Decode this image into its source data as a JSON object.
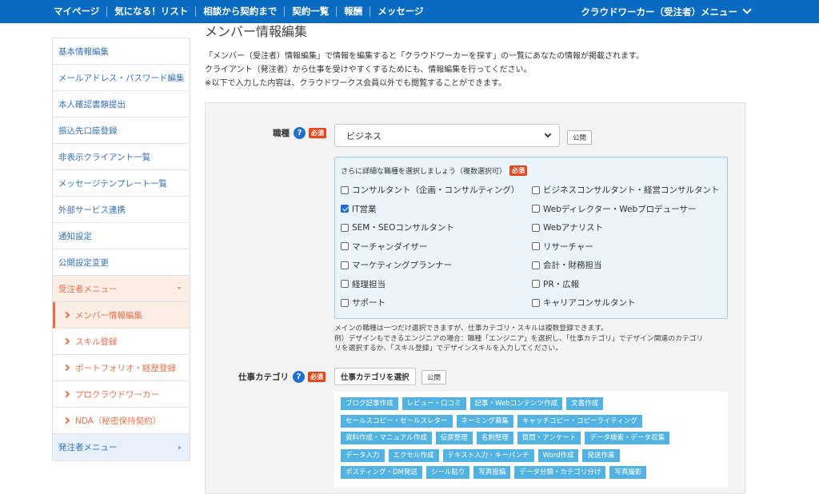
{
  "topnav": {
    "items": [
      "マイページ",
      "気になる！リスト",
      "相談から契約まで",
      "契約一覧",
      "報酬",
      "メッセージ"
    ],
    "menu_label": "クラウドワーカー（受注者）メニュー"
  },
  "sidebar": {
    "items": [
      "基本情報編集",
      "メールアドレス・パスワード編集",
      "本人確認書類提出",
      "振込先口座登録",
      "非表示クライアント一覧",
      "メッセージテンプレート一覧",
      "外部サービス連携",
      "通知設定",
      "公開設定変更"
    ],
    "worker_menu": "受注者メニュー",
    "worker_sub": [
      "メンバー情報編集",
      "スキル登録",
      "ポートフォリオ・経歴登録",
      "プロクラウドワーカー",
      "NDA（秘密保持契約）"
    ],
    "client_menu": "発注者メニュー"
  },
  "main": {
    "title": "メンバー情報編集",
    "intro": [
      "「メンバー（受注者）情報編集」で情報を編集すると「クラウドワーカーを探す」の一覧にあなたの情報が掲載されます。",
      "クライアント（発注者）から仕事を受けやすくするためにも、情報編集を行ってください。",
      "※以下で入力した内容は、クラウドワークス会員以外でも閲覧することができます。"
    ],
    "job_type": {
      "label": "職種",
      "help": "?",
      "required": "必須",
      "value": "ビジネス",
      "public_label": "公開"
    },
    "detail": {
      "heading": "さらに詳細な職種を選択しましょう（複数選択可）",
      "required": "必須",
      "options_left": [
        {
          "label": "コンサルタント（企画・コンサルティング）",
          "checked": false
        },
        {
          "label": "IT営業",
          "checked": true
        },
        {
          "label": "SEM・SEOコンサルタント",
          "checked": false
        },
        {
          "label": "マーチャンダイザー",
          "checked": false
        },
        {
          "label": "マーケティングプランナー",
          "checked": false
        },
        {
          "label": "経理担当",
          "checked": false
        },
        {
          "label": "サポート",
          "checked": false
        }
      ],
      "options_right": [
        {
          "label": "ビジネスコンサルタント・経営コンサルタント",
          "checked": false
        },
        {
          "label": "Webディレクター・Webプロデューサー",
          "checked": false
        },
        {
          "label": "Webアナリスト",
          "checked": false
        },
        {
          "label": "リサーチャー",
          "checked": false
        },
        {
          "label": "会計・財務担当",
          "checked": false
        },
        {
          "label": "PR・広報",
          "checked": false
        },
        {
          "label": "キャリアコンサルタント",
          "checked": false
        }
      ]
    },
    "note": [
      "メインの職種は一つだけ選択できますが、仕事カテゴリ・スキルは複数登録できます。",
      "例）デザインもできるエンジニアの場合：職種「エンジニア」を選択し、「仕事カテゴリ」でデザイン関連のカテゴリ",
      "リを選択するか、「スキル登録」でデザインスキルを入力してください。"
    ],
    "category": {
      "label": "仕事カテゴリ",
      "help": "?",
      "required": "必須",
      "select_button": "仕事カテゴリを選択",
      "public_label": "公開",
      "tag_rows": [
        [
          "ブログ記事作成",
          "レビュー・口コミ",
          "記事・Webコンテンツ作成",
          "文書作成"
        ],
        [
          "セールスコピー・セールスレター",
          "ネーミング募集",
          "キャッチコピー・コピーライティング"
        ],
        [
          "資料作成・マニュアル作成",
          "伝票整理",
          "名刺整理",
          "質問・アンケート",
          "データ検索・データ収集"
        ],
        [
          "データ入力",
          "エクセル作成",
          "テキスト入力・キーパンチ",
          "Word作成",
          "発送作業"
        ],
        [
          "ポスティング・DM発送",
          "シール貼り",
          "写真投稿",
          "データ分類・カテゴリ分け",
          "写真撮影"
        ]
      ]
    }
  },
  "colors": {
    "topbar": "#0a6bc2",
    "accent_orange": "#e8714a",
    "tag_blue": "#52b3e3",
    "required_red": "#e8471c"
  }
}
